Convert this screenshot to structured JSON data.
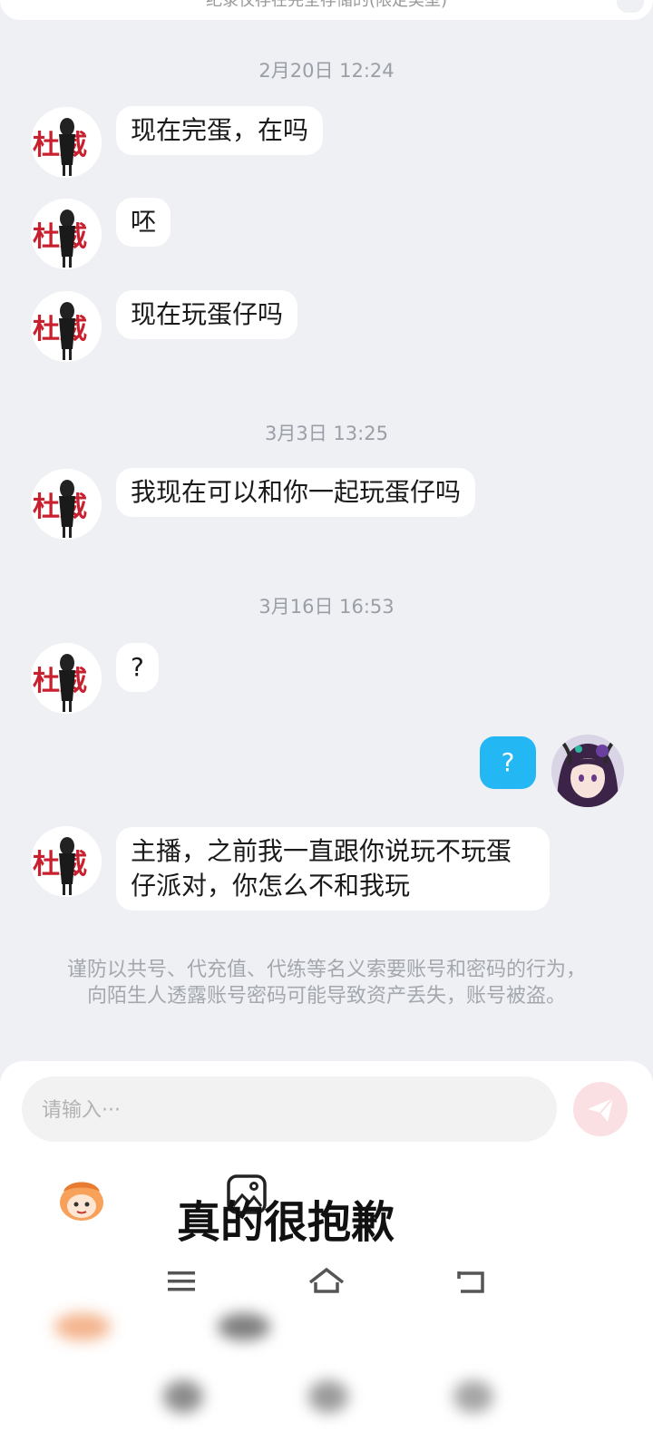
{
  "top_cut_text": "纪录仅存在完全存储的(限定类型)",
  "timestamps": [
    "2月20日 12:24",
    "3月3日 13:25",
    "3月16日 16:53"
  ],
  "messages": [
    "现在完蛋，在吗",
    "呸",
    "现在玩蛋仔吗",
    "我现在可以和你一起玩蛋仔吗",
    "?",
    "?",
    "主播，之前我一直跟你说玩不玩蛋仔派对，你怎么不和我玩"
  ],
  "avatar_stamp_text": "杜威",
  "notice": "谨防以共号、代充值、代练等名义索要账号和密码的行为，向陌生人透露账号密码可能导致资产丢失，账号被盗。",
  "input": {
    "placeholder": "请输入···"
  },
  "caption": "真的很抱歉",
  "colors": {
    "background": "#eef0f4",
    "bubble": "#ffffff",
    "my_bubble": "#23b8f3",
    "send_button": "#fbe0e3",
    "timestamp": "#9a9ea6"
  },
  "icons": {
    "send": "paper-plane-icon",
    "emoji": "cartoon-face-icon",
    "image": "image-icon",
    "nav_menu": "menu-icon",
    "nav_home": "home-icon",
    "nav_back": "back-icon"
  }
}
